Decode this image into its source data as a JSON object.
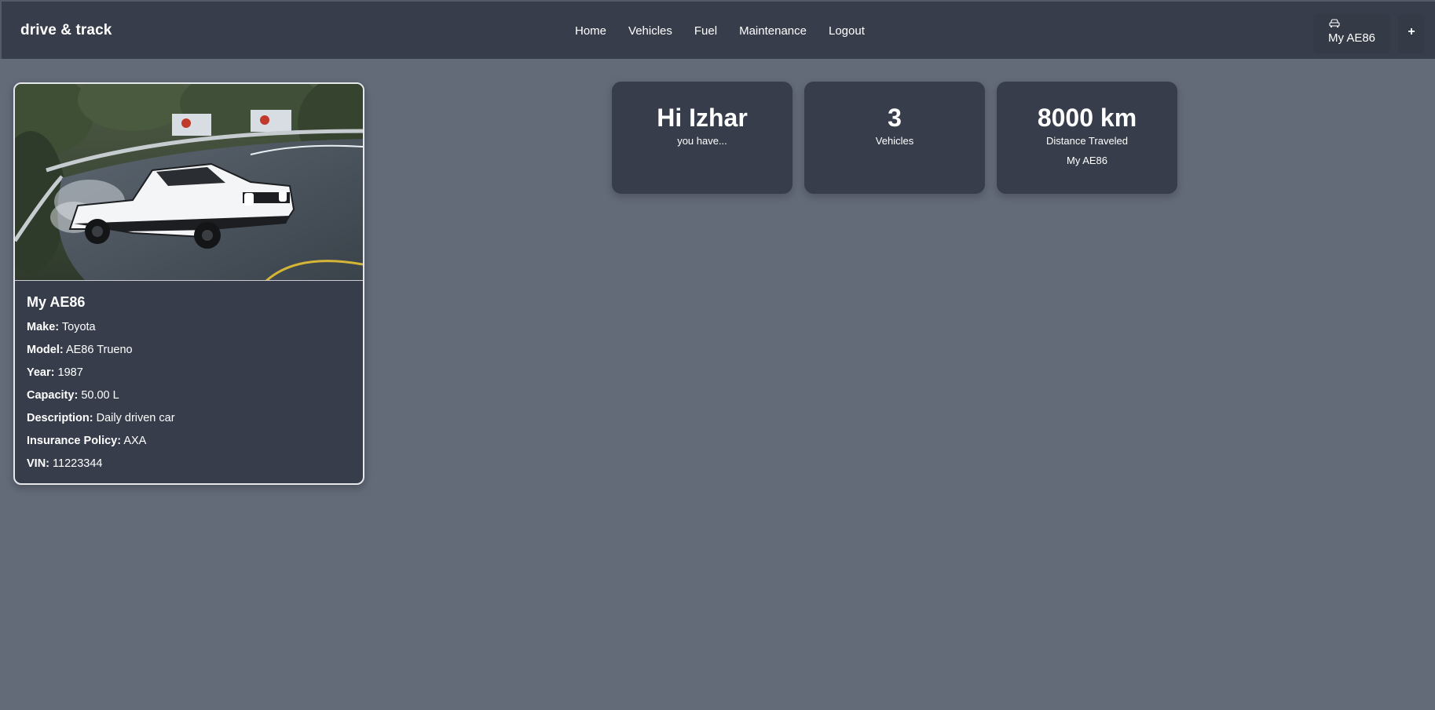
{
  "app": {
    "brand": "drive & track"
  },
  "nav": {
    "links": [
      "Home",
      "Vehicles",
      "Fuel",
      "Maintenance",
      "Logout"
    ]
  },
  "vehicle_selector": {
    "label": "My AE86",
    "icon": "car-icon"
  },
  "add_button": {
    "label": "+"
  },
  "vehicle_card": {
    "name": "My AE86",
    "image_alt_icon": "car-photo",
    "fields": [
      {
        "key": "Make:",
        "value": "Toyota"
      },
      {
        "key": "Model:",
        "value": "AE86 Trueno"
      },
      {
        "key": "Year:",
        "value": "1987"
      },
      {
        "key": "Capacity:",
        "value": "50.00 L"
      },
      {
        "key": "Description:",
        "value": "Daily driven car"
      },
      {
        "key": "Insurance Policy:",
        "value": "AXA"
      },
      {
        "key": "VIN:",
        "value": "11223344"
      }
    ]
  },
  "stats": {
    "greeting": {
      "big": "Hi Izhar",
      "small": "you have..."
    },
    "vehicles": {
      "big": "3",
      "small": "Vehicles"
    },
    "distance": {
      "big": "8000 km",
      "small": "Distance Traveled",
      "vehicle": "My AE86"
    }
  },
  "colors": {
    "background": "#636a78",
    "panel": "#373d4a",
    "card_border": "#e6e8ec"
  }
}
